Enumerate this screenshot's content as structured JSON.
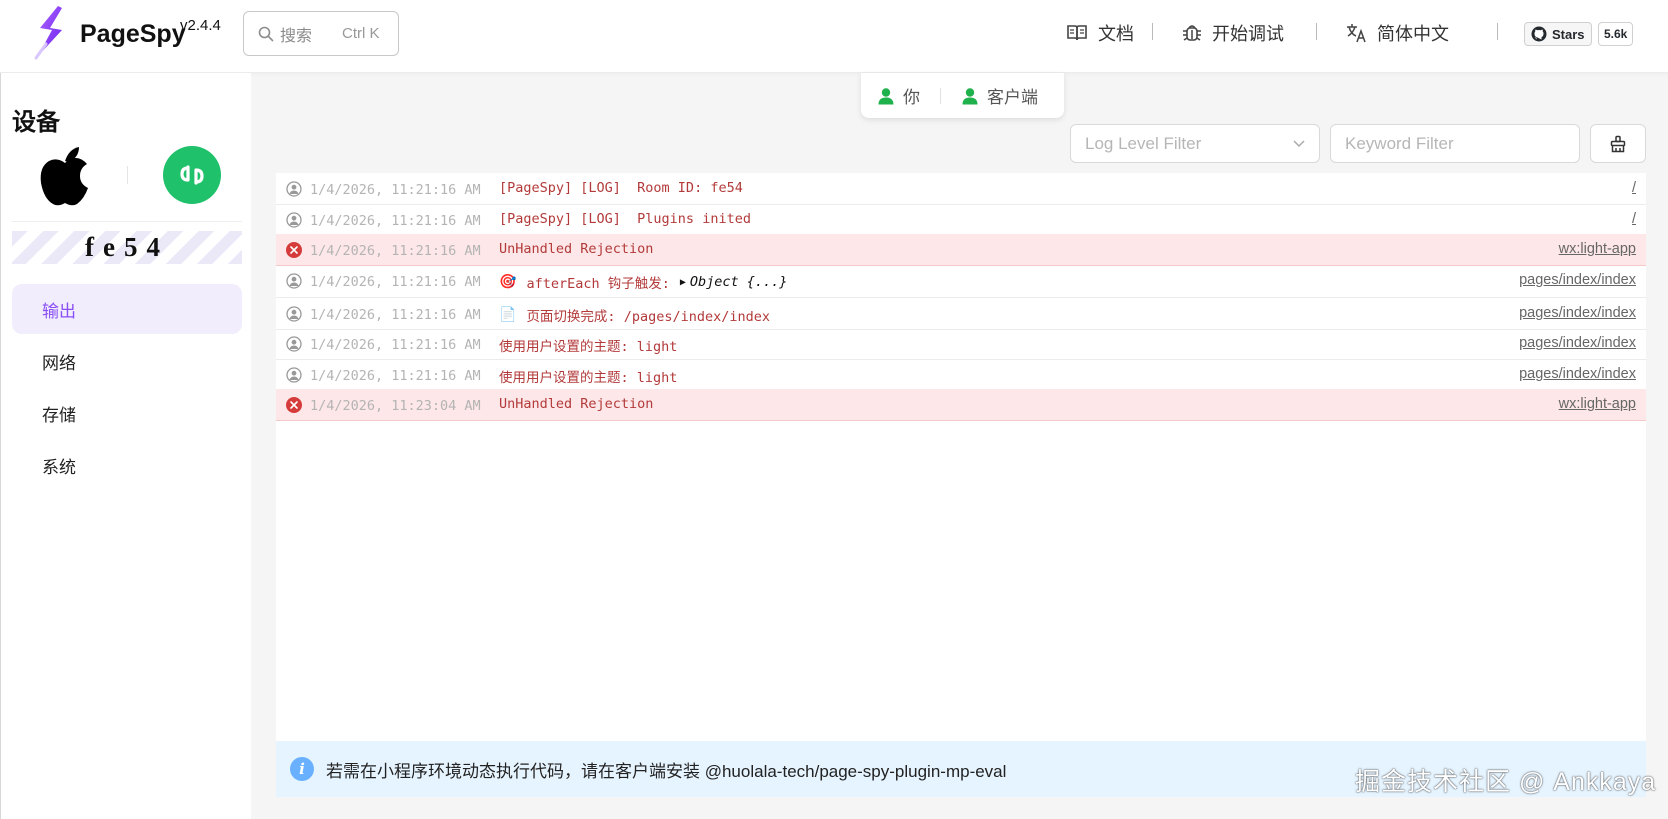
{
  "header": {
    "brand": "PageSpy",
    "version": "v2.4.4",
    "search": {
      "placeholder": "搜索",
      "shortcut": "Ctrl K"
    },
    "nav": [
      {
        "label": "文档",
        "icon": "book-icon"
      },
      {
        "label": "开始调试",
        "icon": "bug-icon"
      },
      {
        "label": "简体中文",
        "icon": "translate-icon"
      }
    ],
    "github": {
      "stars_label": "Stars",
      "count": "5.6k"
    }
  },
  "sidebar": {
    "title": "设备",
    "device_os_icon": "apple-icon",
    "device_app_icon": "mini-program-icon",
    "room_id": "fe54",
    "menu": [
      {
        "label": "输出",
        "active": true
      },
      {
        "label": "网络",
        "active": false
      },
      {
        "label": "存储",
        "active": false
      },
      {
        "label": "系统",
        "active": false
      }
    ]
  },
  "main": {
    "tabs": [
      {
        "label": "你",
        "icon": "user-icon"
      },
      {
        "label": "客户端",
        "icon": "user-icon"
      }
    ],
    "filters": {
      "level_placeholder": "Log Level Filter",
      "keyword_placeholder": "Keyword Filter"
    },
    "logs": [
      {
        "type": "log",
        "time": "1/4/2026, 11:21:16 AM",
        "message": "[PageSpy] [LOG]  Room ID: fe54",
        "emoji": "",
        "object": "",
        "source": "/"
      },
      {
        "type": "log",
        "time": "1/4/2026, 11:21:16 AM",
        "message": "[PageSpy] [LOG]  Plugins inited",
        "emoji": "",
        "object": "",
        "source": "/"
      },
      {
        "type": "error",
        "time": "1/4/2026, 11:21:16 AM",
        "message": "UnHandled Rejection",
        "emoji": "",
        "object": "",
        "source": "wx:light-app"
      },
      {
        "type": "log",
        "time": "1/4/2026, 11:21:16 AM",
        "message": "afterEach 钩子触发:",
        "emoji": "🎯",
        "object": "Object {...}",
        "source": "pages/index/index"
      },
      {
        "type": "log",
        "time": "1/4/2026, 11:21:16 AM",
        "message": "页面切换完成: /pages/index/index",
        "emoji": "📄",
        "object": "",
        "source": "pages/index/index"
      },
      {
        "type": "log",
        "time": "1/4/2026, 11:21:16 AM",
        "message": "使用用户设置的主题: light",
        "emoji": "",
        "object": "",
        "source": "pages/index/index"
      },
      {
        "type": "log",
        "time": "1/4/2026, 11:21:16 AM",
        "message": "使用用户设置的主题: light",
        "emoji": "",
        "object": "",
        "source": "pages/index/index"
      },
      {
        "type": "error",
        "time": "1/4/2026, 11:23:04 AM",
        "message": "UnHandled Rejection",
        "emoji": "",
        "object": "",
        "source": "wx:light-app"
      }
    ],
    "banner": "若需在小程序环境动态执行代码，请在客户端安装 @huolala-tech/page-spy-plugin-mp-eval"
  },
  "watermark": "掘金技术社区 @ Ankkaya",
  "colors": {
    "accent": "#8a4ff5",
    "active_bg": "#f1edfd",
    "error_bg": "#fde7e8",
    "error_icon": "#d63b3b",
    "log_text": "#b33a3a",
    "online": "#1fb14b",
    "banner_bg": "#e6f4ff"
  }
}
